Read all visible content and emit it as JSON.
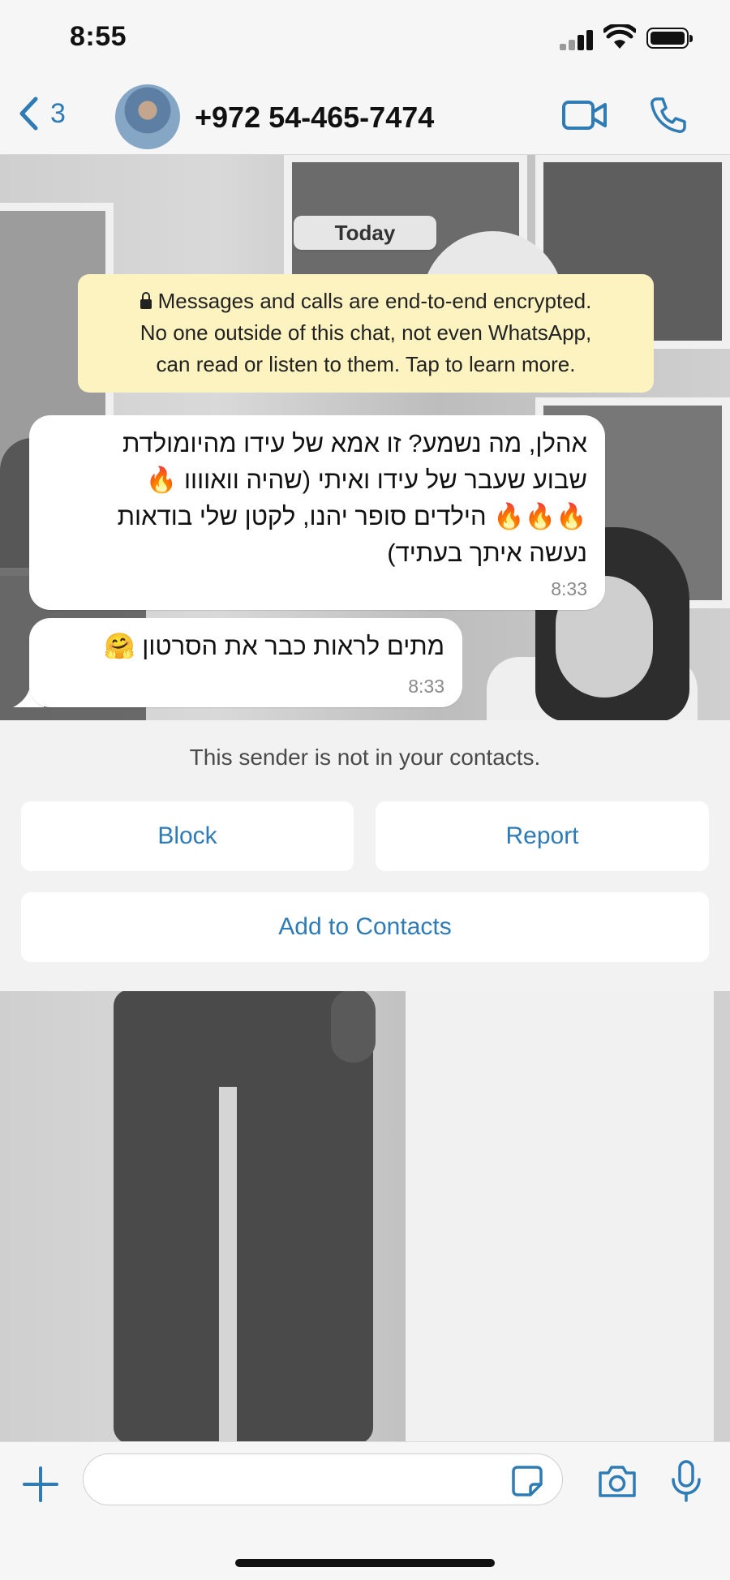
{
  "status_bar": {
    "time": "8:55"
  },
  "header": {
    "back_count": "3",
    "contact_name": "+972 54-465-7474"
  },
  "chat": {
    "date_label": "Today",
    "encryption_notice": {
      "line1": "Messages and calls are end-to-end encrypted.",
      "line2": "No one outside of this chat, not even WhatsApp,",
      "line3": "can read or listen to them. Tap to learn more."
    },
    "messages": [
      {
        "lines": [
          "אהלן, מה נשמע? זו אמא של עידו מהיומולדת",
          "שבוע שעבר של עידו ואיתי (שהיה וואוווו 🔥",
          "🔥🔥🔥 הילדים סופר יהנו, לקטן שלי בודאות",
          "נעשה איתך בעתיד)"
        ],
        "time": "8:33"
      },
      {
        "lines": [
          "מתים לראות כבר את הסרטון 🤗"
        ],
        "time": "8:33"
      }
    ]
  },
  "unknown_sender": {
    "message": "This sender is not in your contacts.",
    "block_label": "Block",
    "report_label": "Report",
    "add_label": "Add to Contacts"
  },
  "input": {
    "placeholder": ""
  },
  "colors": {
    "accent": "#2e7bb5",
    "notice_bg": "#fcf3c1"
  },
  "icons": [
    "chevron-left-icon",
    "video-camera-icon",
    "phone-icon",
    "plus-icon",
    "sticker-icon",
    "camera-icon",
    "microphone-icon"
  ]
}
